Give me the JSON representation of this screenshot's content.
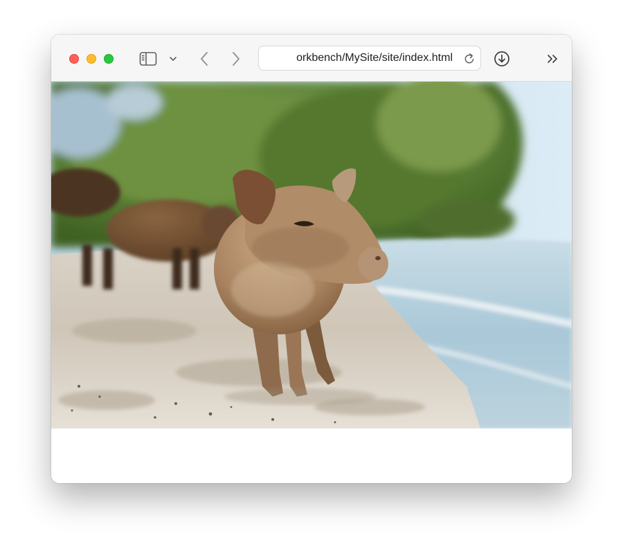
{
  "browser": {
    "url": "orkbench/MySite/site/index.html",
    "window_controls": [
      "close",
      "minimize",
      "zoom"
    ],
    "toolbar_icons": [
      "sidebar-icon",
      "chevron-down-icon",
      "back-icon",
      "forward-icon",
      "reload-icon",
      "download-icon",
      "double-chevron-icon"
    ]
  },
  "page": {
    "image_subject": "piglet on sandy beach"
  },
  "colors": {
    "close": "#ff5f57",
    "minimize": "#febc2e",
    "zoom": "#28c840",
    "toolbar_bg": "#f6f6f6",
    "icon": "#5f5f5f"
  }
}
